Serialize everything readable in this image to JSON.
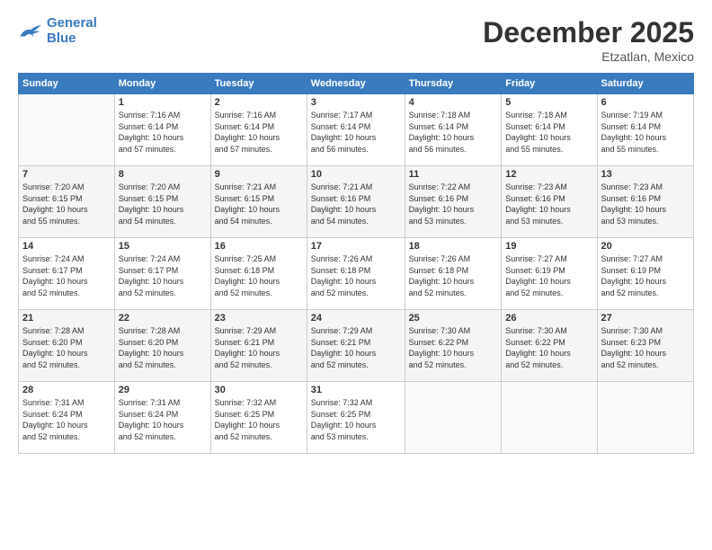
{
  "header": {
    "logo_general": "General",
    "logo_blue": "Blue",
    "month_title": "December 2025",
    "subtitle": "Etzatlan, Mexico"
  },
  "weekdays": [
    "Sunday",
    "Monday",
    "Tuesday",
    "Wednesday",
    "Thursday",
    "Friday",
    "Saturday"
  ],
  "weeks": [
    [
      {
        "day": "",
        "info": ""
      },
      {
        "day": "1",
        "info": "Sunrise: 7:16 AM\nSunset: 6:14 PM\nDaylight: 10 hours\nand 57 minutes."
      },
      {
        "day": "2",
        "info": "Sunrise: 7:16 AM\nSunset: 6:14 PM\nDaylight: 10 hours\nand 57 minutes."
      },
      {
        "day": "3",
        "info": "Sunrise: 7:17 AM\nSunset: 6:14 PM\nDaylight: 10 hours\nand 56 minutes."
      },
      {
        "day": "4",
        "info": "Sunrise: 7:18 AM\nSunset: 6:14 PM\nDaylight: 10 hours\nand 56 minutes."
      },
      {
        "day": "5",
        "info": "Sunrise: 7:18 AM\nSunset: 6:14 PM\nDaylight: 10 hours\nand 55 minutes."
      },
      {
        "day": "6",
        "info": "Sunrise: 7:19 AM\nSunset: 6:14 PM\nDaylight: 10 hours\nand 55 minutes."
      }
    ],
    [
      {
        "day": "7",
        "info": "Sunrise: 7:20 AM\nSunset: 6:15 PM\nDaylight: 10 hours\nand 55 minutes."
      },
      {
        "day": "8",
        "info": "Sunrise: 7:20 AM\nSunset: 6:15 PM\nDaylight: 10 hours\nand 54 minutes."
      },
      {
        "day": "9",
        "info": "Sunrise: 7:21 AM\nSunset: 6:15 PM\nDaylight: 10 hours\nand 54 minutes."
      },
      {
        "day": "10",
        "info": "Sunrise: 7:21 AM\nSunset: 6:16 PM\nDaylight: 10 hours\nand 54 minutes."
      },
      {
        "day": "11",
        "info": "Sunrise: 7:22 AM\nSunset: 6:16 PM\nDaylight: 10 hours\nand 53 minutes."
      },
      {
        "day": "12",
        "info": "Sunrise: 7:23 AM\nSunset: 6:16 PM\nDaylight: 10 hours\nand 53 minutes."
      },
      {
        "day": "13",
        "info": "Sunrise: 7:23 AM\nSunset: 6:16 PM\nDaylight: 10 hours\nand 53 minutes."
      }
    ],
    [
      {
        "day": "14",
        "info": "Sunrise: 7:24 AM\nSunset: 6:17 PM\nDaylight: 10 hours\nand 52 minutes."
      },
      {
        "day": "15",
        "info": "Sunrise: 7:24 AM\nSunset: 6:17 PM\nDaylight: 10 hours\nand 52 minutes."
      },
      {
        "day": "16",
        "info": "Sunrise: 7:25 AM\nSunset: 6:18 PM\nDaylight: 10 hours\nand 52 minutes."
      },
      {
        "day": "17",
        "info": "Sunrise: 7:26 AM\nSunset: 6:18 PM\nDaylight: 10 hours\nand 52 minutes."
      },
      {
        "day": "18",
        "info": "Sunrise: 7:26 AM\nSunset: 6:18 PM\nDaylight: 10 hours\nand 52 minutes."
      },
      {
        "day": "19",
        "info": "Sunrise: 7:27 AM\nSunset: 6:19 PM\nDaylight: 10 hours\nand 52 minutes."
      },
      {
        "day": "20",
        "info": "Sunrise: 7:27 AM\nSunset: 6:19 PM\nDaylight: 10 hours\nand 52 minutes."
      }
    ],
    [
      {
        "day": "21",
        "info": "Sunrise: 7:28 AM\nSunset: 6:20 PM\nDaylight: 10 hours\nand 52 minutes."
      },
      {
        "day": "22",
        "info": "Sunrise: 7:28 AM\nSunset: 6:20 PM\nDaylight: 10 hours\nand 52 minutes."
      },
      {
        "day": "23",
        "info": "Sunrise: 7:29 AM\nSunset: 6:21 PM\nDaylight: 10 hours\nand 52 minutes."
      },
      {
        "day": "24",
        "info": "Sunrise: 7:29 AM\nSunset: 6:21 PM\nDaylight: 10 hours\nand 52 minutes."
      },
      {
        "day": "25",
        "info": "Sunrise: 7:30 AM\nSunset: 6:22 PM\nDaylight: 10 hours\nand 52 minutes."
      },
      {
        "day": "26",
        "info": "Sunrise: 7:30 AM\nSunset: 6:22 PM\nDaylight: 10 hours\nand 52 minutes."
      },
      {
        "day": "27",
        "info": "Sunrise: 7:30 AM\nSunset: 6:23 PM\nDaylight: 10 hours\nand 52 minutes."
      }
    ],
    [
      {
        "day": "28",
        "info": "Sunrise: 7:31 AM\nSunset: 6:24 PM\nDaylight: 10 hours\nand 52 minutes."
      },
      {
        "day": "29",
        "info": "Sunrise: 7:31 AM\nSunset: 6:24 PM\nDaylight: 10 hours\nand 52 minutes."
      },
      {
        "day": "30",
        "info": "Sunrise: 7:32 AM\nSunset: 6:25 PM\nDaylight: 10 hours\nand 52 minutes."
      },
      {
        "day": "31",
        "info": "Sunrise: 7:32 AM\nSunset: 6:25 PM\nDaylight: 10 hours\nand 53 minutes."
      },
      {
        "day": "",
        "info": ""
      },
      {
        "day": "",
        "info": ""
      },
      {
        "day": "",
        "info": ""
      }
    ]
  ]
}
